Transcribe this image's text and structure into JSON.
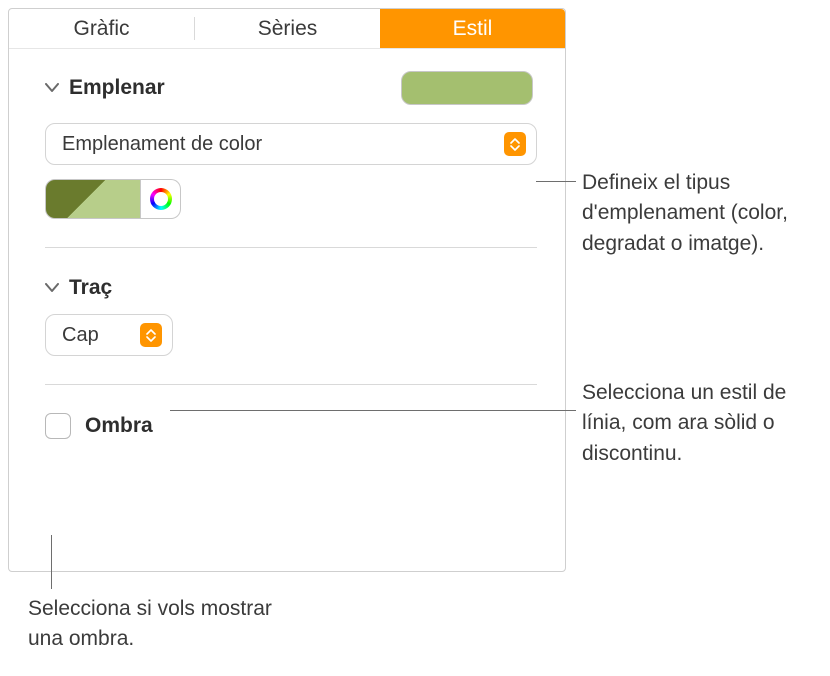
{
  "tabs": {
    "chart": "Gràfic",
    "series": "Sèries",
    "style": "Estil"
  },
  "sections": {
    "fill": {
      "title": "Emplenar",
      "dropdown_label": "Emplenament de color",
      "fill_color": "#a4bf6f"
    },
    "stroke": {
      "title": "Traç",
      "dropdown_label": "Cap"
    },
    "shadow": {
      "label": "Ombra",
      "checked": false
    }
  },
  "callouts": {
    "fill": "Defineix el tipus d'emplenament (color, degradat o imatge).",
    "stroke": "Selecciona un estil de línia, com ara sòlid o discontinu.",
    "shadow": "Selecciona si vols mostrar una ombra."
  }
}
